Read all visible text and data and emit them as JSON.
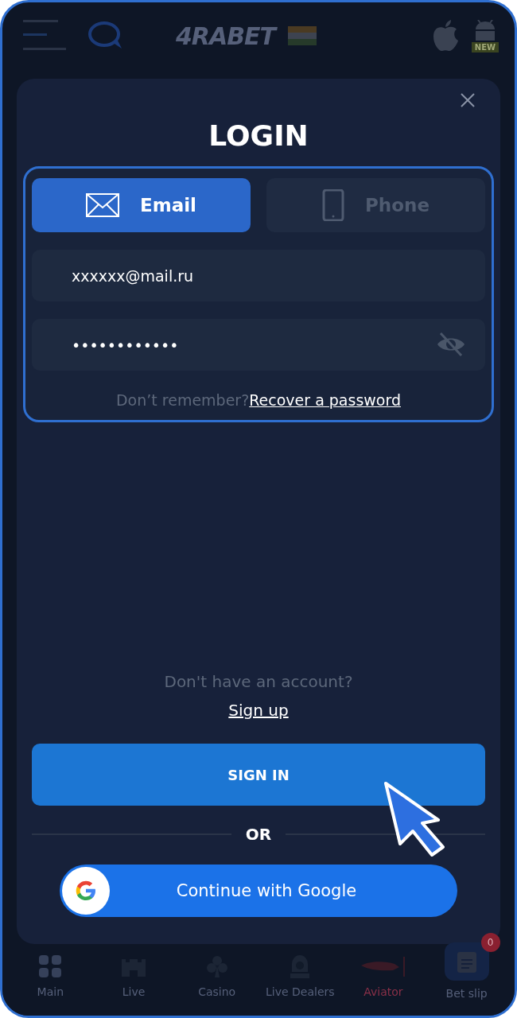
{
  "header": {
    "logo": "4RABET",
    "new_badge": "NEW"
  },
  "modal": {
    "title": "LOGIN",
    "tabs": [
      {
        "label": "Email",
        "kind": "email",
        "selected": true
      },
      {
        "label": "Phone",
        "kind": "phone",
        "selected": false
      }
    ],
    "email_field": {
      "value": "xxxxxx@mail.ru"
    },
    "password_field": {
      "value": "••••••••••••"
    },
    "forgot": {
      "text": "Don’t remember?",
      "link": "Recover a password"
    },
    "signup": {
      "text": "Don't have an account?",
      "link": "Sign up"
    },
    "sign_in_button": "SIGN IN",
    "divider": "OR",
    "google_button": "Continue with Google"
  },
  "bottom_nav": [
    {
      "label": "Main",
      "kind": "grid"
    },
    {
      "label": "Live",
      "kind": "castle"
    },
    {
      "label": "Casino",
      "kind": "club"
    },
    {
      "label": "Live Dealers",
      "kind": "dealer"
    },
    {
      "label": "Aviator",
      "kind": "plane"
    },
    {
      "label": "Bet slip",
      "kind": "slip",
      "badge": "0"
    }
  ]
}
